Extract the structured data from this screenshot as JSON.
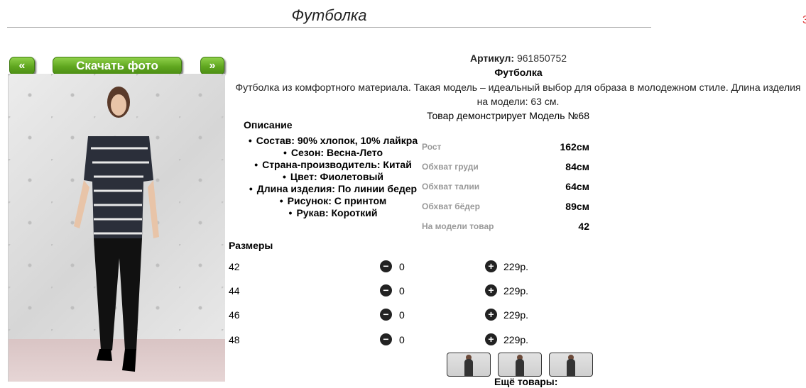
{
  "header": {
    "title": "Футболка"
  },
  "gallery": {
    "prev_label": "«",
    "download_label": "Скачать фото",
    "next_label": "»"
  },
  "product": {
    "sku_label": "Артикул:",
    "sku_value": "961850752",
    "name": "Футболка",
    "description": "Футболка из комфортного материала. Такая модель – идеальный выбор для образа в молодежном стиле. Длина изделия на модели: 63 см.",
    "model_note": "Товар демонстрирует Модель №68"
  },
  "description_section": {
    "heading": "Описание",
    "features": [
      "Состав: 90% хлопок, 10% лайкра",
      "Сезон: Весна-Лето",
      "Страна-производитель: Китай",
      "Цвет: Фиолетовый",
      "Длина изделия: По линии бедер",
      "Рисунок: С принтом",
      "Рукав: Короткий"
    ]
  },
  "model_measurements": [
    {
      "label": "Рост",
      "value": "162см"
    },
    {
      "label": "Обхват груди",
      "value": "84см"
    },
    {
      "label": "Обхват талии",
      "value": "64см"
    },
    {
      "label": "Обхват бёдер",
      "value": "89см"
    },
    {
      "label": "На модели товар",
      "value": "42"
    }
  ],
  "sizes": {
    "heading": "Размеры",
    "minus_symbol": "−",
    "plus_symbol": "+",
    "rows": [
      {
        "size": "42",
        "qty": "0",
        "price": "229р."
      },
      {
        "size": "44",
        "qty": "0",
        "price": "229р."
      },
      {
        "size": "46",
        "qty": "0",
        "price": "229р."
      },
      {
        "size": "48",
        "qty": "0",
        "price": "229р."
      }
    ]
  },
  "more_goods_label": "Ещё товары:",
  "colors": {
    "button_green": "#5fa61f",
    "label_gray": "#999999"
  }
}
